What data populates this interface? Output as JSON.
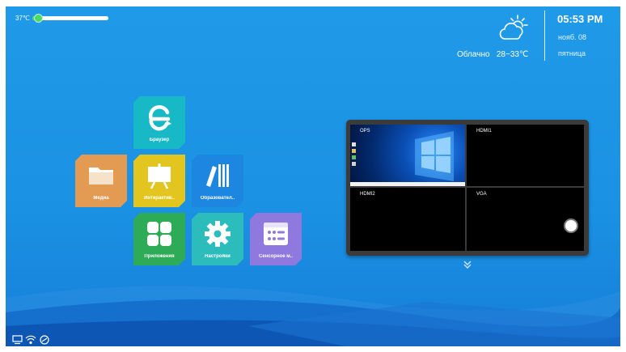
{
  "status": {
    "temperature": "37℃",
    "temperature_fraction": 0.08
  },
  "weather": {
    "condition": "Облачно",
    "range": "28~33℃",
    "icon": "cloud-sun-icon"
  },
  "clock": {
    "time": "05:53 PM",
    "date": "нояб. 08",
    "weekday": "пятница"
  },
  "apps": [
    {
      "label": "Браузер",
      "color": "#18b9c6",
      "icon": "browser-e-icon"
    },
    {
      "label": "Медиа",
      "color": "#e39b54",
      "icon": "folder-icon"
    },
    {
      "label": "Интерактив..",
      "color": "#e3c520",
      "icon": "whiteboard-icon"
    },
    {
      "label": "Образовател..",
      "color": "#1d86e0",
      "icon": "books-icon"
    },
    {
      "label": "Приложения",
      "color": "#2dab56",
      "icon": "apps-grid-icon"
    },
    {
      "label": "Настройки",
      "color": "#2cbcbc",
      "icon": "gear-icon"
    },
    {
      "label": "Сенсорное м..",
      "color": "#8f78de",
      "icon": "touch-menu-icon"
    }
  ],
  "sources": [
    {
      "label": "OPS"
    },
    {
      "label": "HDMI1"
    },
    {
      "label": "HDMI2"
    },
    {
      "label": "VGA"
    }
  ],
  "icons": {
    "expand": "chevron-double-down-icon",
    "taskbar": [
      "monitor-icon",
      "wifi-icon",
      "signal-icon"
    ]
  }
}
